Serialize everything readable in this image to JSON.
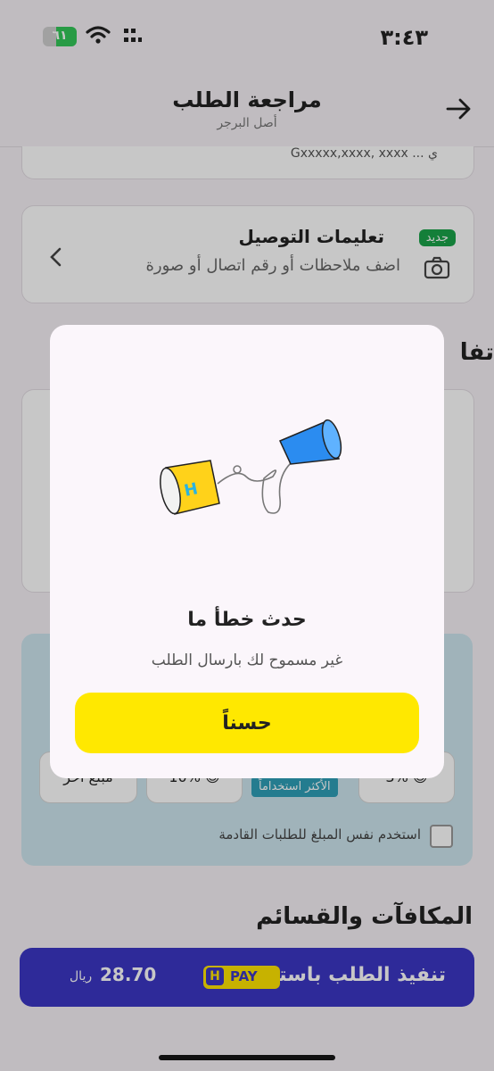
{
  "status": {
    "time": "٣:٤٣",
    "battery": "٦١"
  },
  "header": {
    "title": "مراجعة الطلب",
    "subtitle": "أصل البرجر"
  },
  "address": {
    "partial": "ي ... Gxxxxx,xxxx, xxxx"
  },
  "delivery": {
    "badge": "جديد",
    "title": "تعليمات التوصيل",
    "subtitle": "اضف ملاحظات أو رقم اتصال أو صورة"
  },
  "sections": {
    "partial_title": "تفا",
    "rewards": "المكافآت والقسائم"
  },
  "tip": {
    "options": [
      "مبلغ آخر",
      "10% 😍",
      "الأكثر استخداماً",
      "3% 😊"
    ],
    "checkbox_label": "استخدم نفس المبلغ للطلبات القادمة"
  },
  "pay": {
    "label": "تنفيذ الطلب باستخدام",
    "badge_h": "H",
    "badge_pay": "PAY",
    "amount": "28.70",
    "currency": "ريال"
  },
  "modal": {
    "title": "حدث خطأ ما",
    "message": "غير مسموح لك بارسال الطلب",
    "ok": "حسناً"
  },
  "colors": {
    "accent": "#ffe800",
    "pay_bg": "#3b37c4",
    "badge_green": "#1aa34a"
  }
}
